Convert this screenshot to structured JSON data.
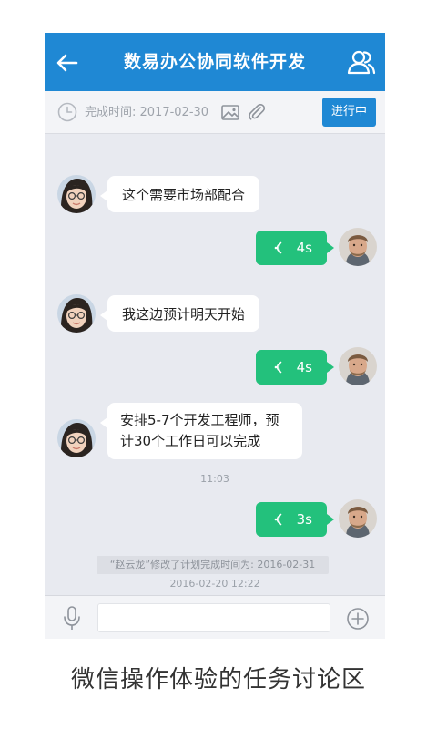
{
  "header": {
    "title": "数易办公协同软件开发",
    "back_icon": "arrow-left-icon",
    "members_icon": "people-icon"
  },
  "info_bar": {
    "due_label": "完成时间: 2017-02-30",
    "status": "进行中",
    "clock_icon": "clock-icon",
    "image_icon": "image-icon",
    "attach_icon": "paperclip-icon"
  },
  "messages": [
    {
      "side": "left",
      "type": "text",
      "text": "这个需要市场部配合"
    },
    {
      "side": "right",
      "type": "voice",
      "duration": "4s"
    },
    {
      "side": "left",
      "type": "text",
      "text": "我这边预计明天开始"
    },
    {
      "side": "right",
      "type": "voice",
      "duration": "4s"
    },
    {
      "side": "left",
      "type": "text",
      "text": "安排5-7个开发工程师，预计30个工作日可以完成"
    },
    {
      "side": "center",
      "type": "time",
      "text": "11:03"
    },
    {
      "side": "right",
      "type": "voice",
      "duration": "3s"
    },
    {
      "side": "center",
      "type": "system",
      "text": "“赵云龙”修改了计划完成时间为: 2016-02-31"
    },
    {
      "side": "center",
      "type": "time",
      "text": "2016-02-20 12:22"
    }
  ],
  "input_bar": {
    "placeholder": "",
    "mic_icon": "microphone-icon",
    "add_icon": "plus-circle-icon"
  },
  "caption": "微信操作体验的任务讨论区",
  "colors": {
    "primary": "#1f88d4",
    "voice_bubble": "#23c17c",
    "background": "#e8eaf0"
  }
}
